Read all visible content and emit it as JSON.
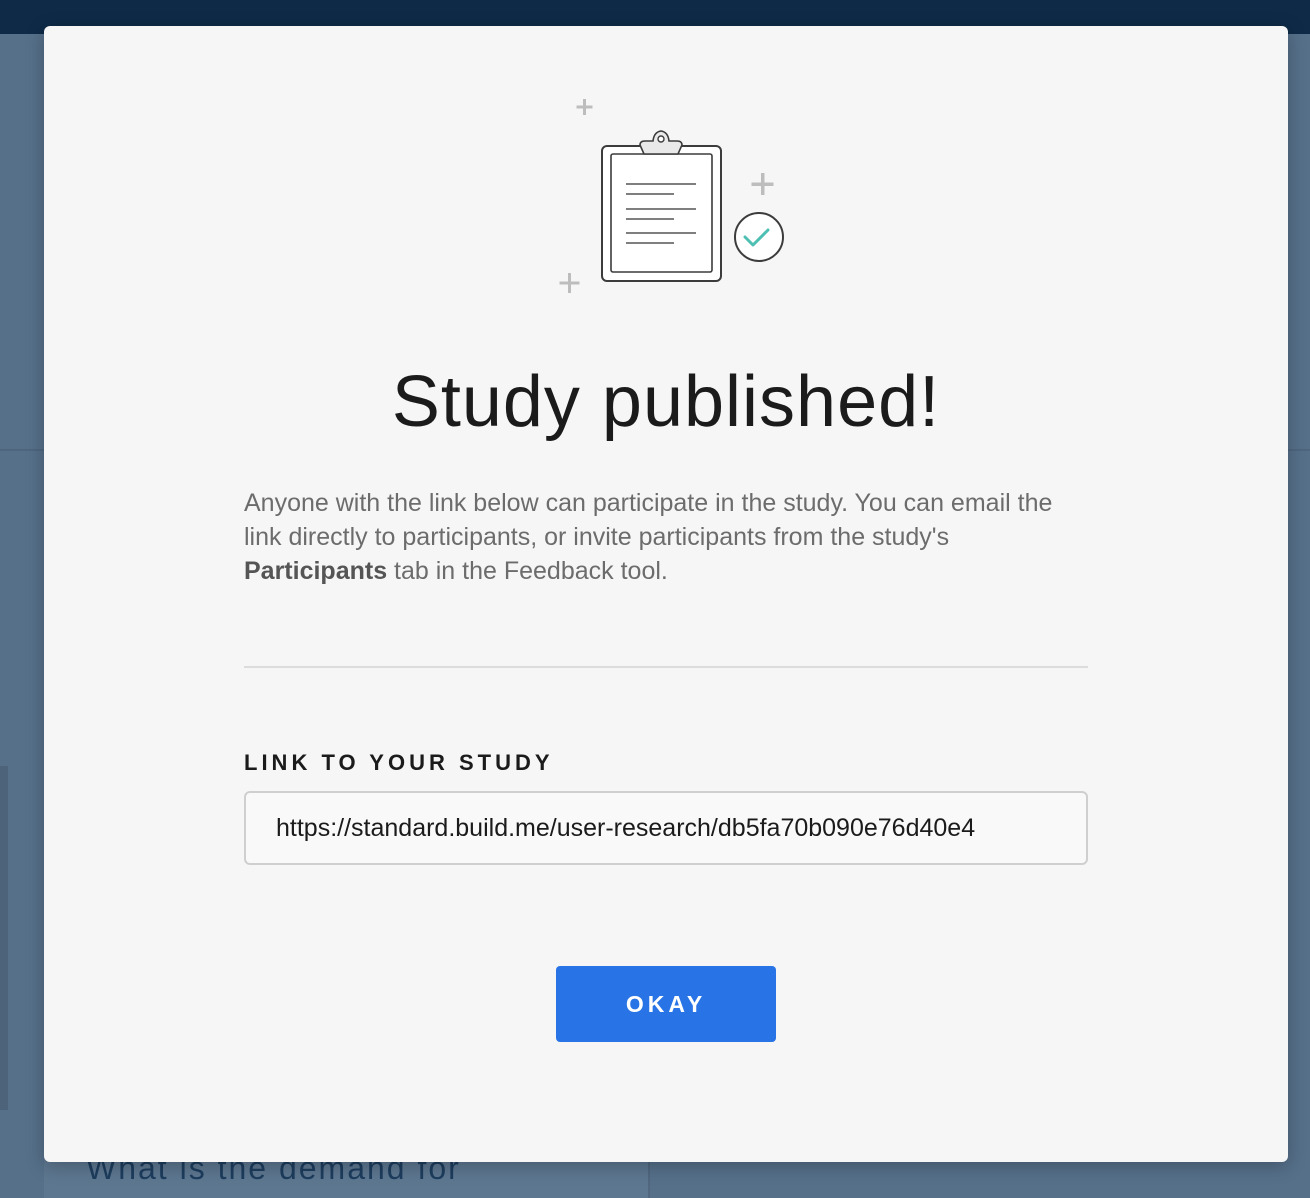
{
  "background": {
    "card_text": "What is the demand for"
  },
  "modal": {
    "illustration_icon": "clipboard-check-icon",
    "title": "Study published!",
    "description": {
      "before": "Anyone with the link below can participate in the study. You can email the link directly to participants, or invite participants from the study's ",
      "bold": "Participants",
      "after": " tab in the Feedback tool."
    },
    "link_label": "LINK TO YOUR STUDY",
    "link_value": "https://standard.build.me/user-research/db5fa70b090e76d40e4",
    "okay_label": "OKAY"
  },
  "colors": {
    "accent": "#2874e6",
    "check": "#4dbfb3",
    "topbar": "#0e2a47",
    "overlay": "#56708a"
  }
}
